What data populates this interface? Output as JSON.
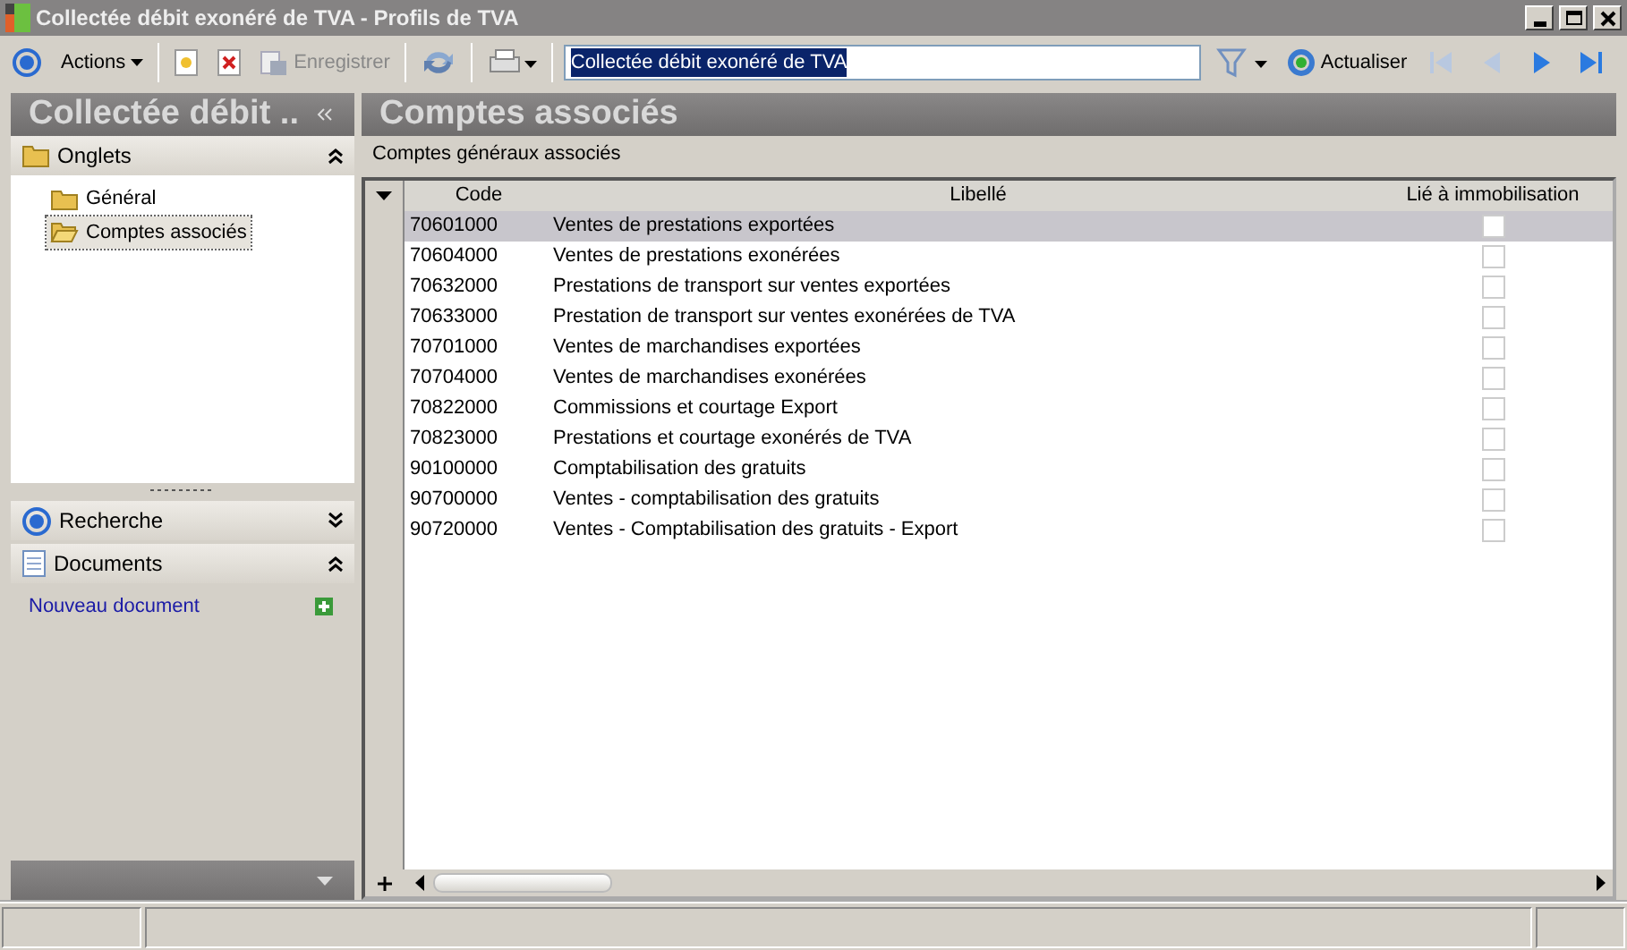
{
  "window": {
    "title": "Collectée débit exonéré de TVA -  Profils de TVA"
  },
  "toolbar": {
    "actions": "Actions",
    "save": {
      "label": "Enregistrer",
      "disabled": true
    },
    "search": {
      "value": "Collectée débit exonéré de TVA"
    },
    "refresh": "Actualiser",
    "nav": [
      {
        "kind": "first",
        "disabled": true
      },
      {
        "kind": "prev",
        "disabled": true
      },
      {
        "kind": "next",
        "disabled": false
      },
      {
        "kind": "last",
        "disabled": false
      }
    ]
  },
  "sidebar": {
    "title": "Collectée débit ..",
    "sections": [
      {
        "kind": "tabs",
        "label": "Onglets",
        "expanded": true,
        "items": [
          {
            "label": "Général",
            "selected": false
          },
          {
            "label": "Comptes associés",
            "selected": true
          }
        ]
      },
      {
        "kind": "search",
        "label": "Recherche",
        "expanded": false
      },
      {
        "kind": "documents",
        "label": "Documents",
        "expanded": true,
        "link": "Nouveau document"
      }
    ]
  },
  "main": {
    "title": "Comptes associés",
    "subtitle": "Comptes généraux associés",
    "table": {
      "columns": [
        "Code",
        "Libellé",
        "Lié à immobilisation"
      ],
      "rows": [
        {
          "code": "70601000",
          "label": "Ventes de prestations exportées",
          "checked": false,
          "selected": true
        },
        {
          "code": "70604000",
          "label": "Ventes de prestations exonérées",
          "checked": false,
          "selected": false
        },
        {
          "code": "70632000",
          "label": "Prestations de transport sur ventes exportées",
          "checked": false,
          "selected": false
        },
        {
          "code": "70633000",
          "label": "Prestation de transport sur ventes exonérées de TVA",
          "checked": false,
          "selected": false
        },
        {
          "code": "70701000",
          "label": "Ventes de marchandises exportées",
          "checked": false,
          "selected": false
        },
        {
          "code": "70704000",
          "label": "Ventes de marchandises exonérées",
          "checked": false,
          "selected": false
        },
        {
          "code": "70822000",
          "label": "Commissions et courtage Export",
          "checked": false,
          "selected": false
        },
        {
          "code": "70823000",
          "label": "Prestations et courtage exonérés de TVA",
          "checked": false,
          "selected": false
        },
        {
          "code": "90100000",
          "label": "Comptabilisation des gratuits",
          "checked": false,
          "selected": false
        },
        {
          "code": "90700000",
          "label": "Ventes - comptabilisation des gratuits",
          "checked": false,
          "selected": false
        },
        {
          "code": "90720000",
          "label": "Ventes - Comptabilisation des gratuits - Export",
          "checked": false,
          "selected": false
        }
      ]
    }
  }
}
